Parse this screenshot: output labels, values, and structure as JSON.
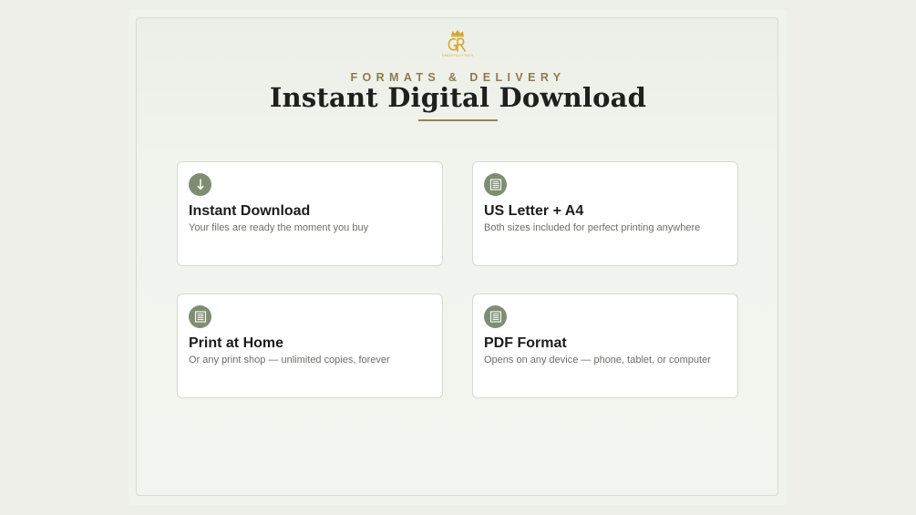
{
  "header": {
    "logo": {
      "icon": "crown-monogram-logo",
      "monogram": "GR",
      "tagline": "GRACEFULLY RICH",
      "gold": "#d4a72c"
    },
    "eyebrow": "FORMATS & DELIVERY",
    "title": "Instant Digital Download"
  },
  "theme": {
    "accent": "#9b8258",
    "icon_bg": "#7f8d73",
    "background": "#edefe8"
  },
  "cards": [
    {
      "icon": "download-arrow-icon",
      "glyph": "↓",
      "title": "Instant Download",
      "description": "Your files are ready the moment you buy"
    },
    {
      "icon": "document-icon",
      "glyph": "▤",
      "title": "US Letter + A4",
      "description": "Both sizes included for perfect printing anywhere"
    },
    {
      "icon": "document-icon",
      "glyph": "▤",
      "title": "Print at Home",
      "description": "Or any print shop — unlimited copies, forever"
    },
    {
      "icon": "document-icon",
      "glyph": "▤",
      "title": "PDF Format",
      "description": "Opens on any device — phone, tablet, or computer"
    }
  ]
}
